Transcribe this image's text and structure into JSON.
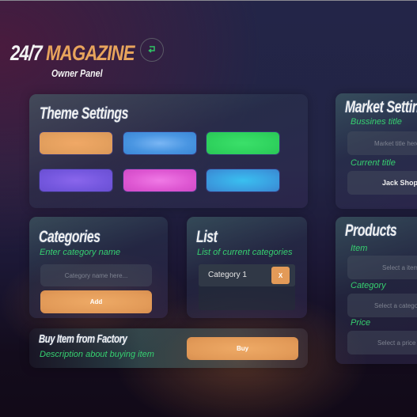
{
  "header": {
    "brand_white": "24/7",
    "brand_orange": "MAGAZINE",
    "subtitle": "Owner Panel",
    "back_icon": "return-arrow-icon"
  },
  "theme_settings": {
    "title": "Theme Settings",
    "swatches": [
      {
        "name": "orange",
        "color": "#e4a05e"
      },
      {
        "name": "blue",
        "color": "#4a96e2"
      },
      {
        "name": "green",
        "color": "#2fd35e"
      },
      {
        "name": "purple",
        "color": "#7457de"
      },
      {
        "name": "pink",
        "color": "#de57d2"
      },
      {
        "name": "cyan",
        "color": "#3a9ee0"
      }
    ]
  },
  "market_settings": {
    "title": "Market Settings",
    "business_title_label": "Bussines title",
    "business_title_placeholder": "Market title here...",
    "current_title_label": "Current title",
    "current_title_value": "Jack Shop"
  },
  "categories": {
    "title": "Categories",
    "label": "Enter category name",
    "placeholder": "Category name here...",
    "add_label": "Add"
  },
  "list": {
    "title": "List",
    "label": "List of current categories",
    "items": [
      {
        "label": "Category 1",
        "remove_label": "X"
      }
    ]
  },
  "products": {
    "title": "Products",
    "item_label": "Item",
    "item_placeholder": "Select a item",
    "category_label": "Category",
    "category_placeholder": "Select a category",
    "price_label": "Price",
    "price_placeholder": "Select a price"
  },
  "buy": {
    "title": "Buy Item from Factory",
    "description": "Description about buying item",
    "button_label": "Buy"
  },
  "colors": {
    "accent_orange": "#e8a45c",
    "label_green": "#36d070",
    "back_icon_green": "#2fc466"
  }
}
